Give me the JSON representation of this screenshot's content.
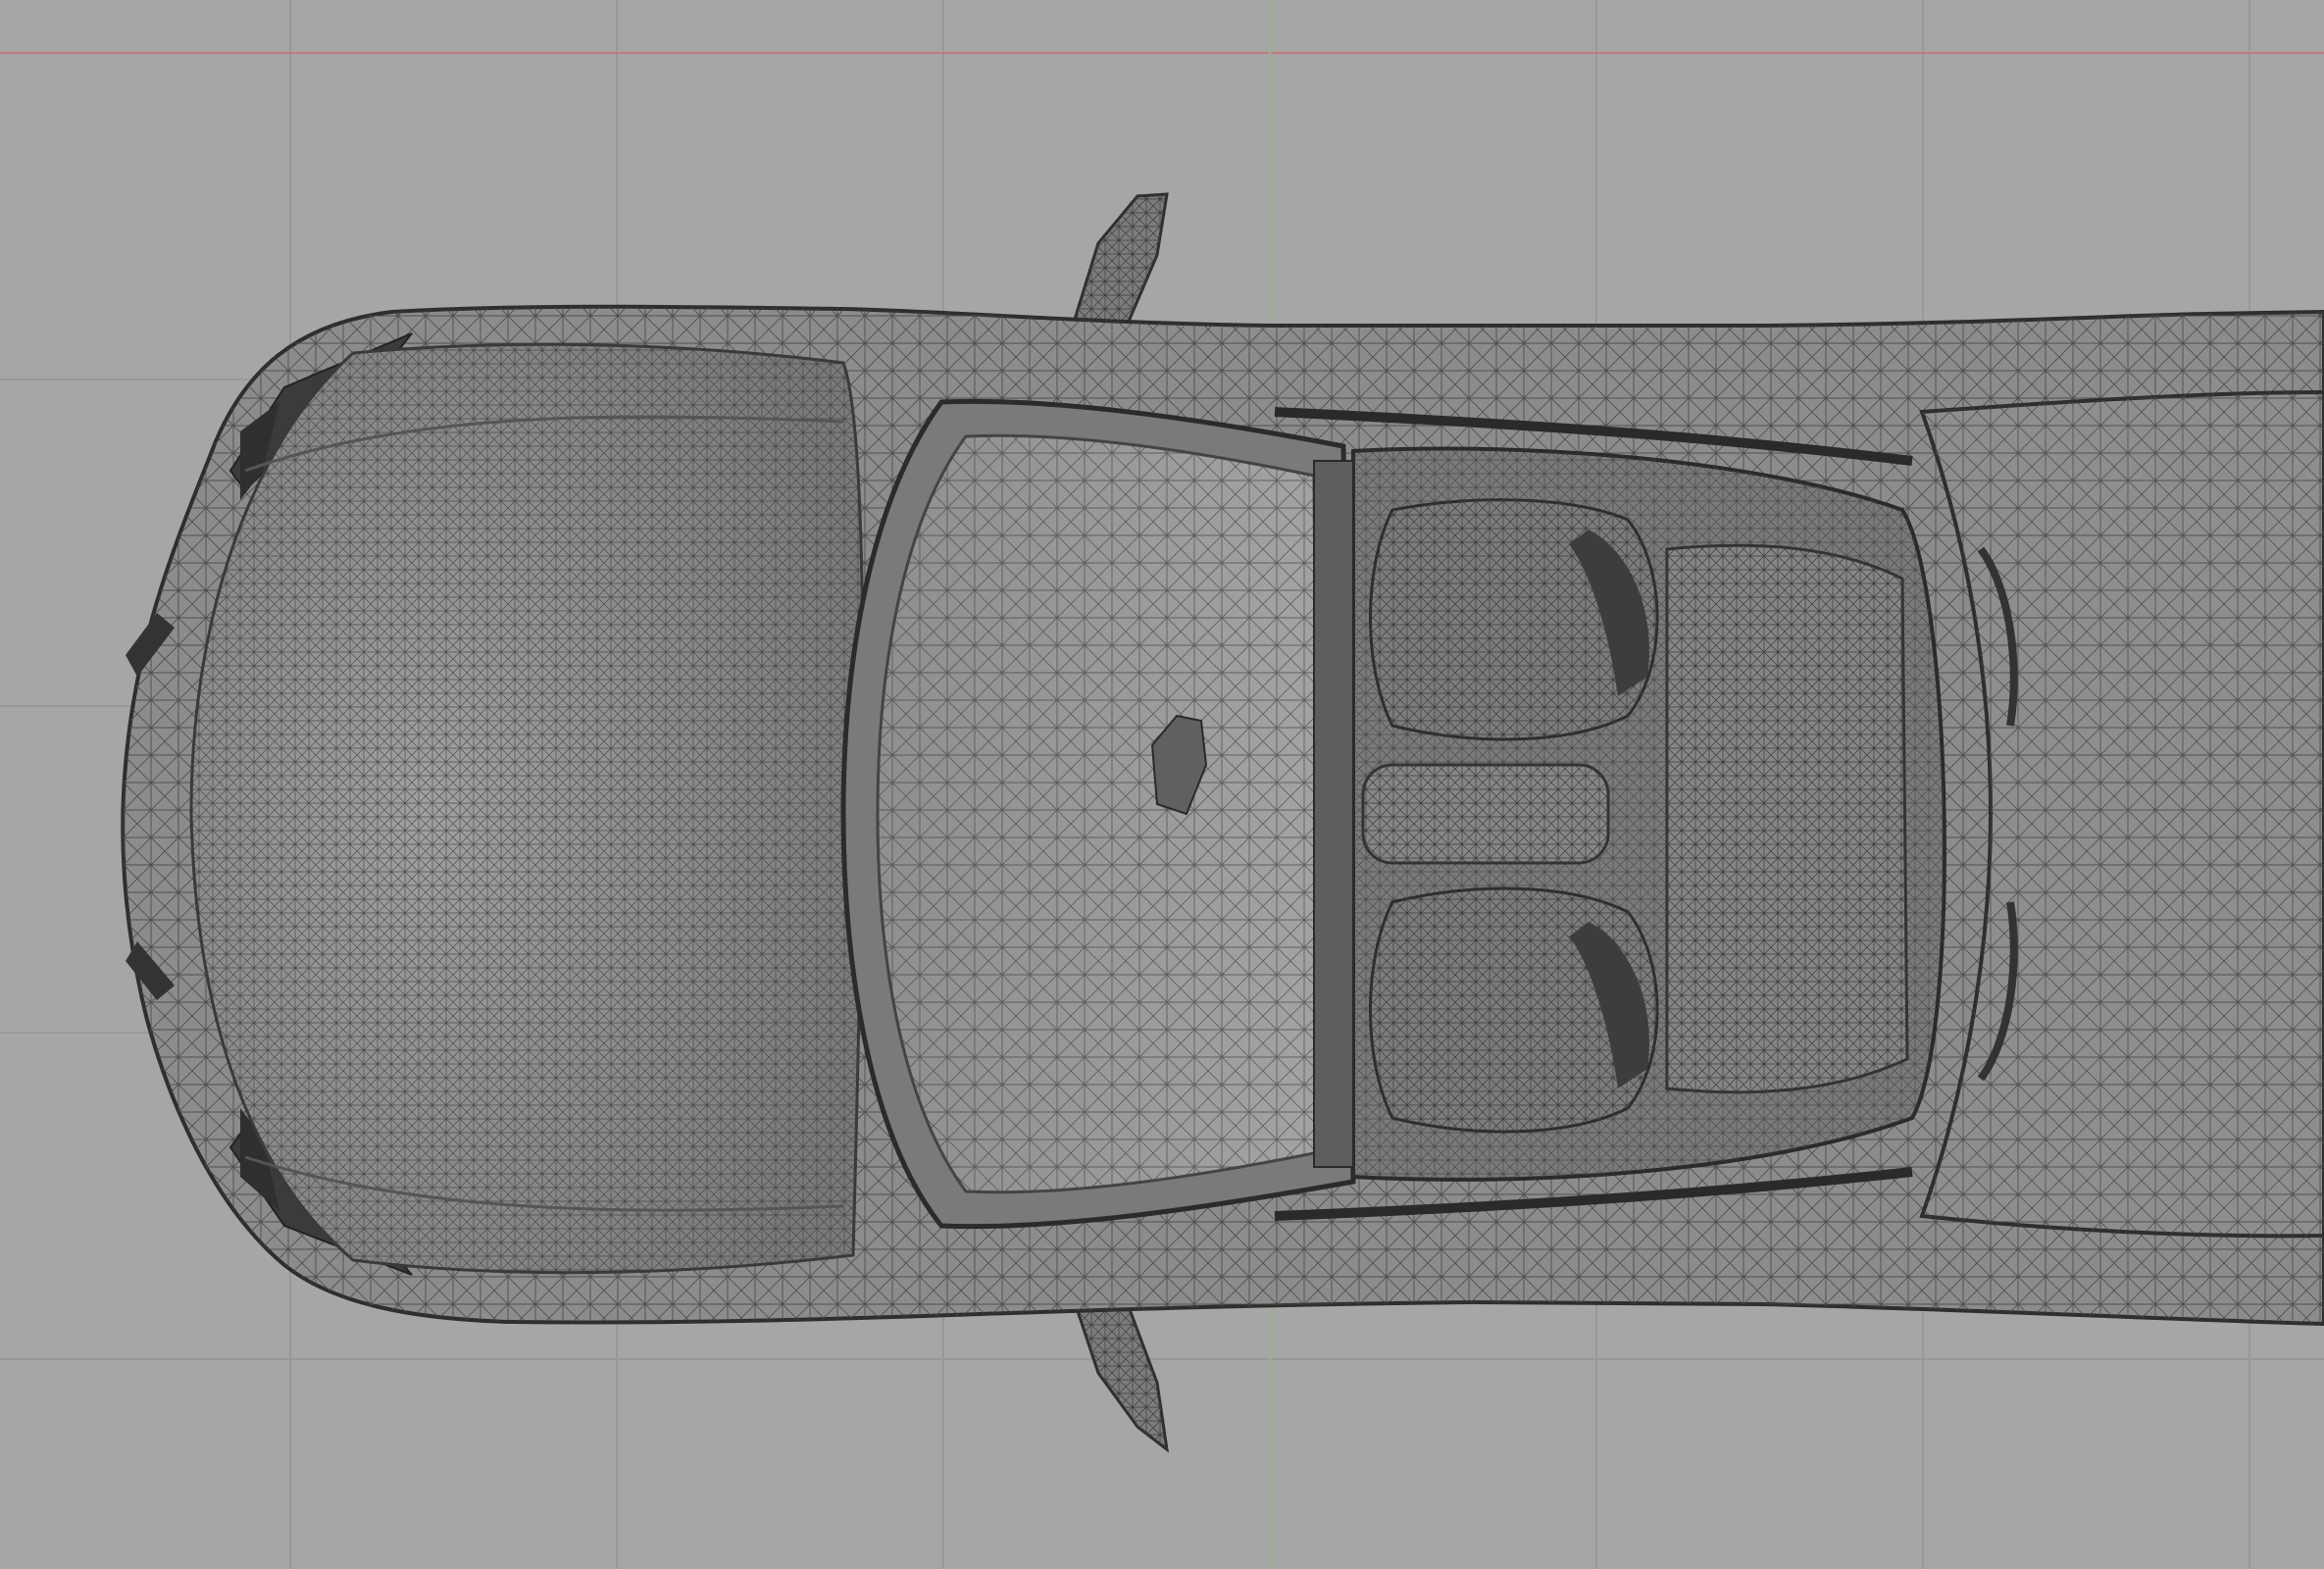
{
  "viewport": {
    "view": "top",
    "display_mode": "wireframe-on-shaded",
    "colors": {
      "background": "#a6a6a6",
      "grid_line": "#989898",
      "x_axis": "#c07a80",
      "y_axis": "#9ab38a",
      "mesh_fill": "#8a8a8a",
      "mesh_shade": "#6d6d6d",
      "wire": "#3a3a3a",
      "dark_panel": "#3f3f3f"
    }
  },
  "model": {
    "object": "convertible-sports-car",
    "orientation": "front-left"
  }
}
